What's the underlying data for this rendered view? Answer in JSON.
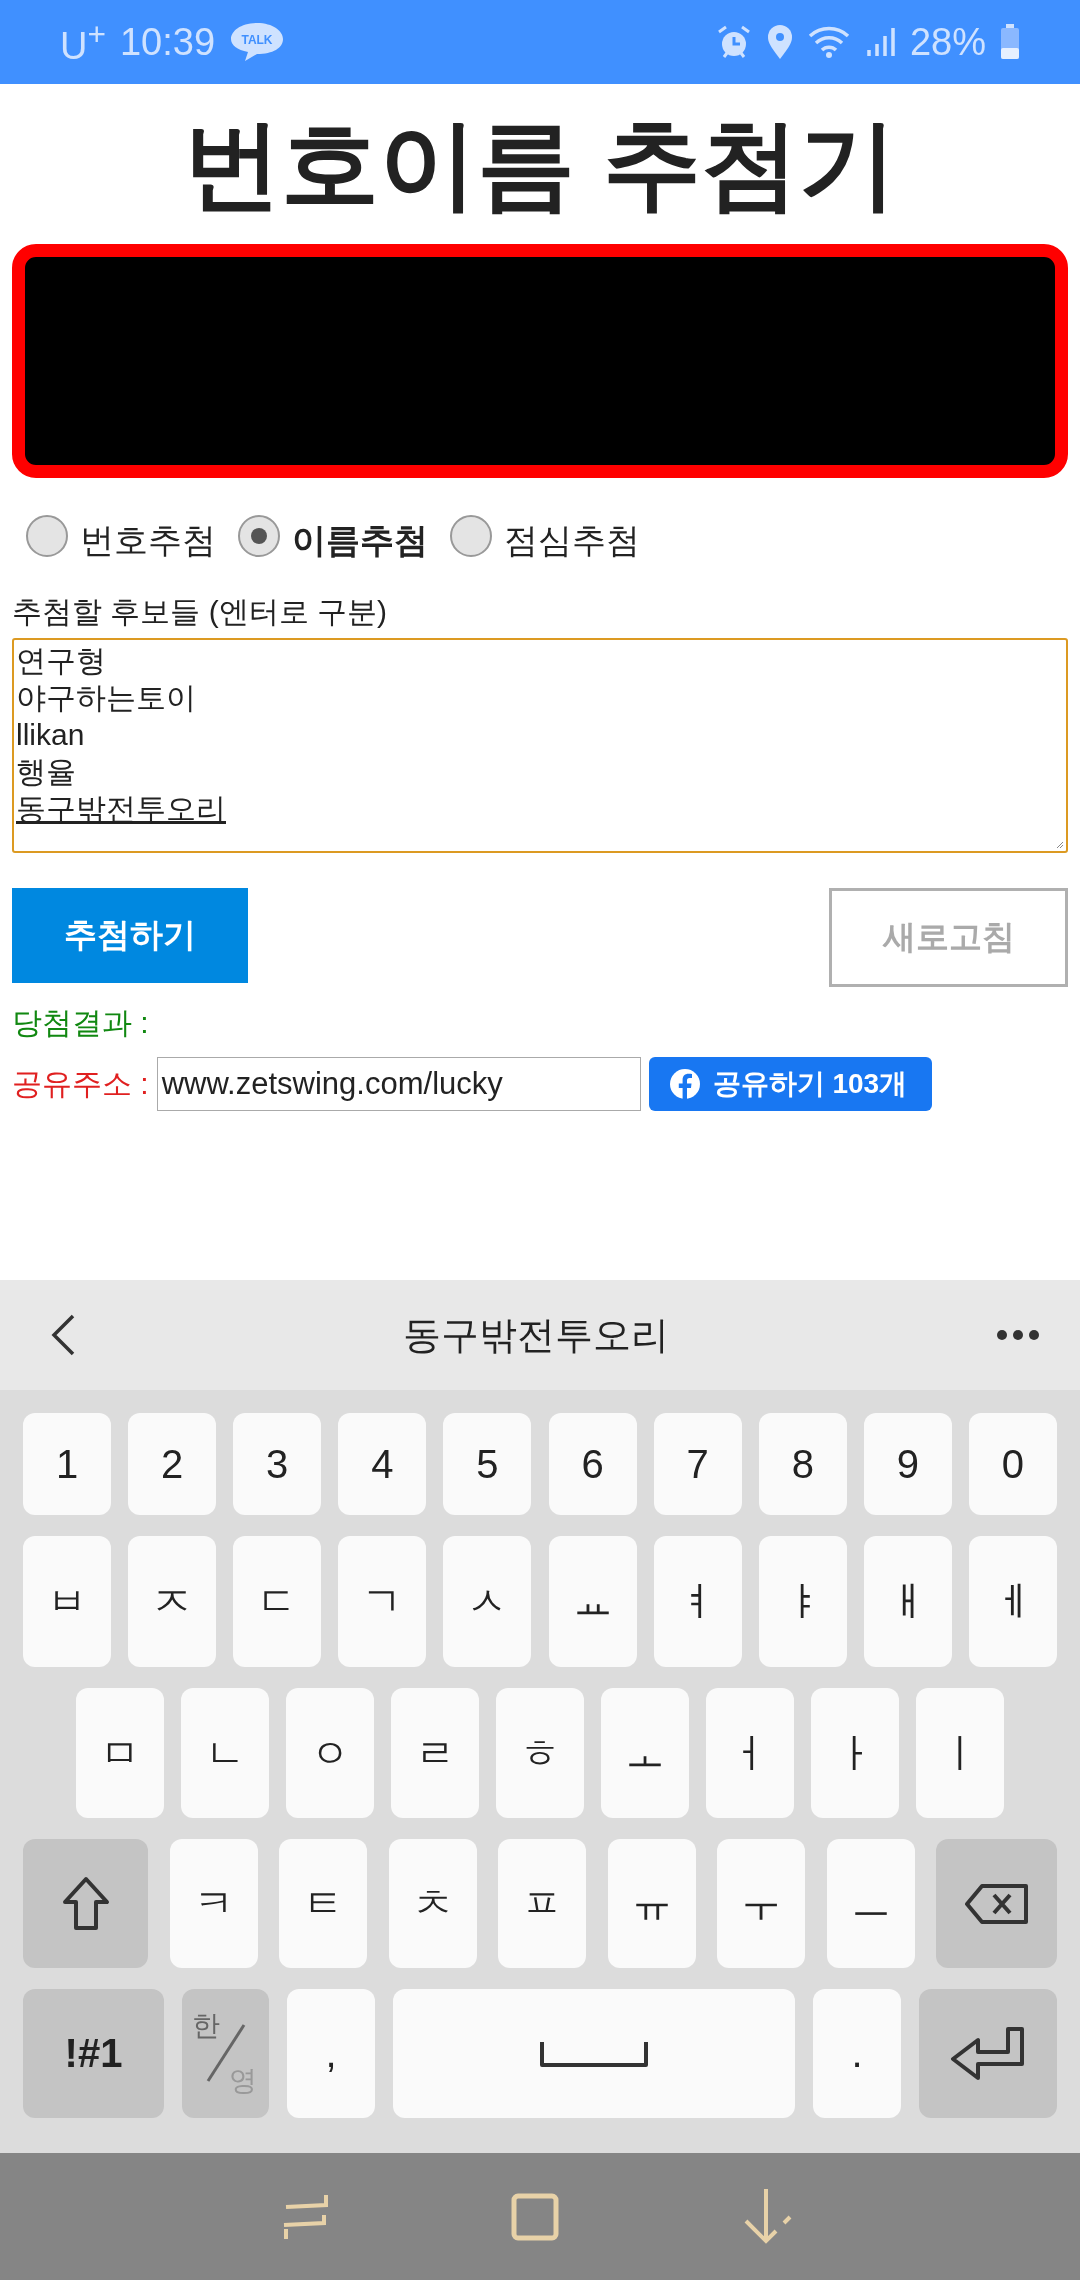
{
  "status_bar": {
    "carrier": "U$^{+}$",
    "time": "10:39",
    "chat_badge": "TALK",
    "battery": "28%"
  },
  "title": "번호이름 추첨기",
  "draw_modes": [
    {
      "label": "번호추첨",
      "selected": false
    },
    {
      "label": "이름추첨",
      "selected": true
    },
    {
      "label": "점심추첨",
      "selected": false
    }
  ],
  "candidates_label": "추첨할 후보들 (엔터로 구분)",
  "candidates": [
    {
      "text": "연구형",
      "composing": false
    },
    {
      "text": "야구하는토이",
      "composing": false
    },
    {
      "text": "llikan",
      "composing": false
    },
    {
      "text": "행율",
      "composing": false
    },
    {
      "text": "동구밖전투오리",
      "composing": true
    }
  ],
  "draw_button": {
    "label": "추첨하기"
  },
  "refresh_button": {
    "label": "새로고침",
    "disabled": true
  },
  "result_label": "당첨결과 :",
  "share": {
    "label": "공유주소 :",
    "url": "www.zetswing.com/lucky",
    "button": "공유하기 103개"
  },
  "keyboard": {
    "suggestion": "동구밖전투오리",
    "rows": [
      [
        {
          "kind": "char",
          "label": "1"
        },
        {
          "kind": "char",
          "label": "2"
        },
        {
          "kind": "char",
          "label": "3"
        },
        {
          "kind": "char",
          "label": "4"
        },
        {
          "kind": "char",
          "label": "5"
        },
        {
          "kind": "char",
          "label": "6"
        },
        {
          "kind": "char",
          "label": "7"
        },
        {
          "kind": "char",
          "label": "8"
        },
        {
          "kind": "char",
          "label": "9"
        },
        {
          "kind": "char",
          "label": "0"
        }
      ],
      [
        {
          "kind": "char",
          "label": "ㅂ"
        },
        {
          "kind": "char",
          "label": "ㅈ"
        },
        {
          "kind": "char",
          "label": "ㄷ"
        },
        {
          "kind": "char",
          "label": "ㄱ"
        },
        {
          "kind": "char",
          "label": "ㅅ"
        },
        {
          "kind": "char",
          "label": "ㅛ"
        },
        {
          "kind": "char",
          "label": "ㅕ"
        },
        {
          "kind": "char",
          "label": "ㅑ"
        },
        {
          "kind": "char",
          "label": "ㅐ"
        },
        {
          "kind": "char",
          "label": "ㅔ"
        }
      ],
      [
        {
          "kind": "char",
          "label": "ㅁ"
        },
        {
          "kind": "char",
          "label": "ㄴ"
        },
        {
          "kind": "char",
          "label": "ㅇ"
        },
        {
          "kind": "char",
          "label": "ㄹ"
        },
        {
          "kind": "char",
          "label": "ㅎ"
        },
        {
          "kind": "char",
          "label": "ㅗ"
        },
        {
          "kind": "char",
          "label": "ㅓ"
        },
        {
          "kind": "char",
          "label": "ㅏ"
        },
        {
          "kind": "char",
          "label": "ㅣ"
        }
      ],
      [
        {
          "kind": "shift"
        },
        {
          "kind": "char",
          "label": "ㅋ"
        },
        {
          "kind": "char",
          "label": "ㅌ"
        },
        {
          "kind": "char",
          "label": "ㅊ"
        },
        {
          "kind": "char",
          "label": "ㅍ"
        },
        {
          "kind": "char",
          "label": "ㅠ"
        },
        {
          "kind": "char",
          "label": "ㅜ"
        },
        {
          "kind": "char",
          "label": "ㅡ"
        },
        {
          "kind": "backspace"
        }
      ],
      [
        {
          "kind": "symbols",
          "label": "!#1"
        },
        {
          "kind": "lang",
          "label": "한",
          "alt": "영"
        },
        {
          "kind": "char",
          "label": ","
        },
        {
          "kind": "space"
        },
        {
          "kind": "char",
          "label": "."
        },
        {
          "kind": "enter"
        }
      ]
    ]
  }
}
